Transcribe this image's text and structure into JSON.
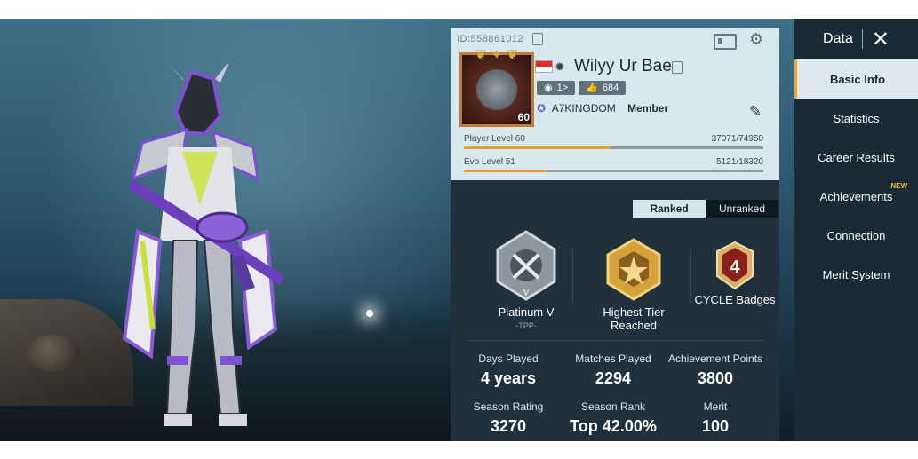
{
  "player": {
    "id": "ID:558861012",
    "name": "Wilyy Ur Bae",
    "level_badge": "60",
    "stats_pills": [
      "1>",
      "684",
      "-"
    ],
    "clan": "A7KINGDOM",
    "clan_role": "Member",
    "player_level_label": "Player Level 60",
    "player_level_xp": "37071/74950",
    "player_level_fraction": 0.49,
    "evo_level_label": "Evo Level 51",
    "evo_level_xp": "5121/18320",
    "evo_level_fraction": 0.28
  },
  "tabs": {
    "ranked": "Ranked",
    "unranked": "Unranked"
  },
  "badges": {
    "tier": "Platinum V",
    "tier_sub": "-TPP-",
    "highest": "Highest Tier Reached",
    "cycle": "CYCLE Badges",
    "cycle_num": "4"
  },
  "stats": [
    {
      "key": "Days Played",
      "value": "4 years"
    },
    {
      "key": "Matches Played",
      "value": "2294"
    },
    {
      "key": "Achievement Points",
      "value": "3800"
    },
    {
      "key": "Season Rating",
      "value": "3270"
    },
    {
      "key": "Season Rank",
      "value": "Top 42.00%"
    },
    {
      "key": "Merit",
      "value": "100"
    }
  ],
  "sidebar": {
    "title": "Data",
    "items": [
      {
        "label": "Basic Info"
      },
      {
        "label": "Statistics"
      },
      {
        "label": "Career Results"
      },
      {
        "label": "Achievements",
        "badge": "NEW"
      },
      {
        "label": "Connection"
      },
      {
        "label": "Merit System"
      }
    ]
  },
  "colors": {
    "accent": "#e39f2b",
    "panel": "#20313d",
    "card": "#d7e9ef"
  }
}
